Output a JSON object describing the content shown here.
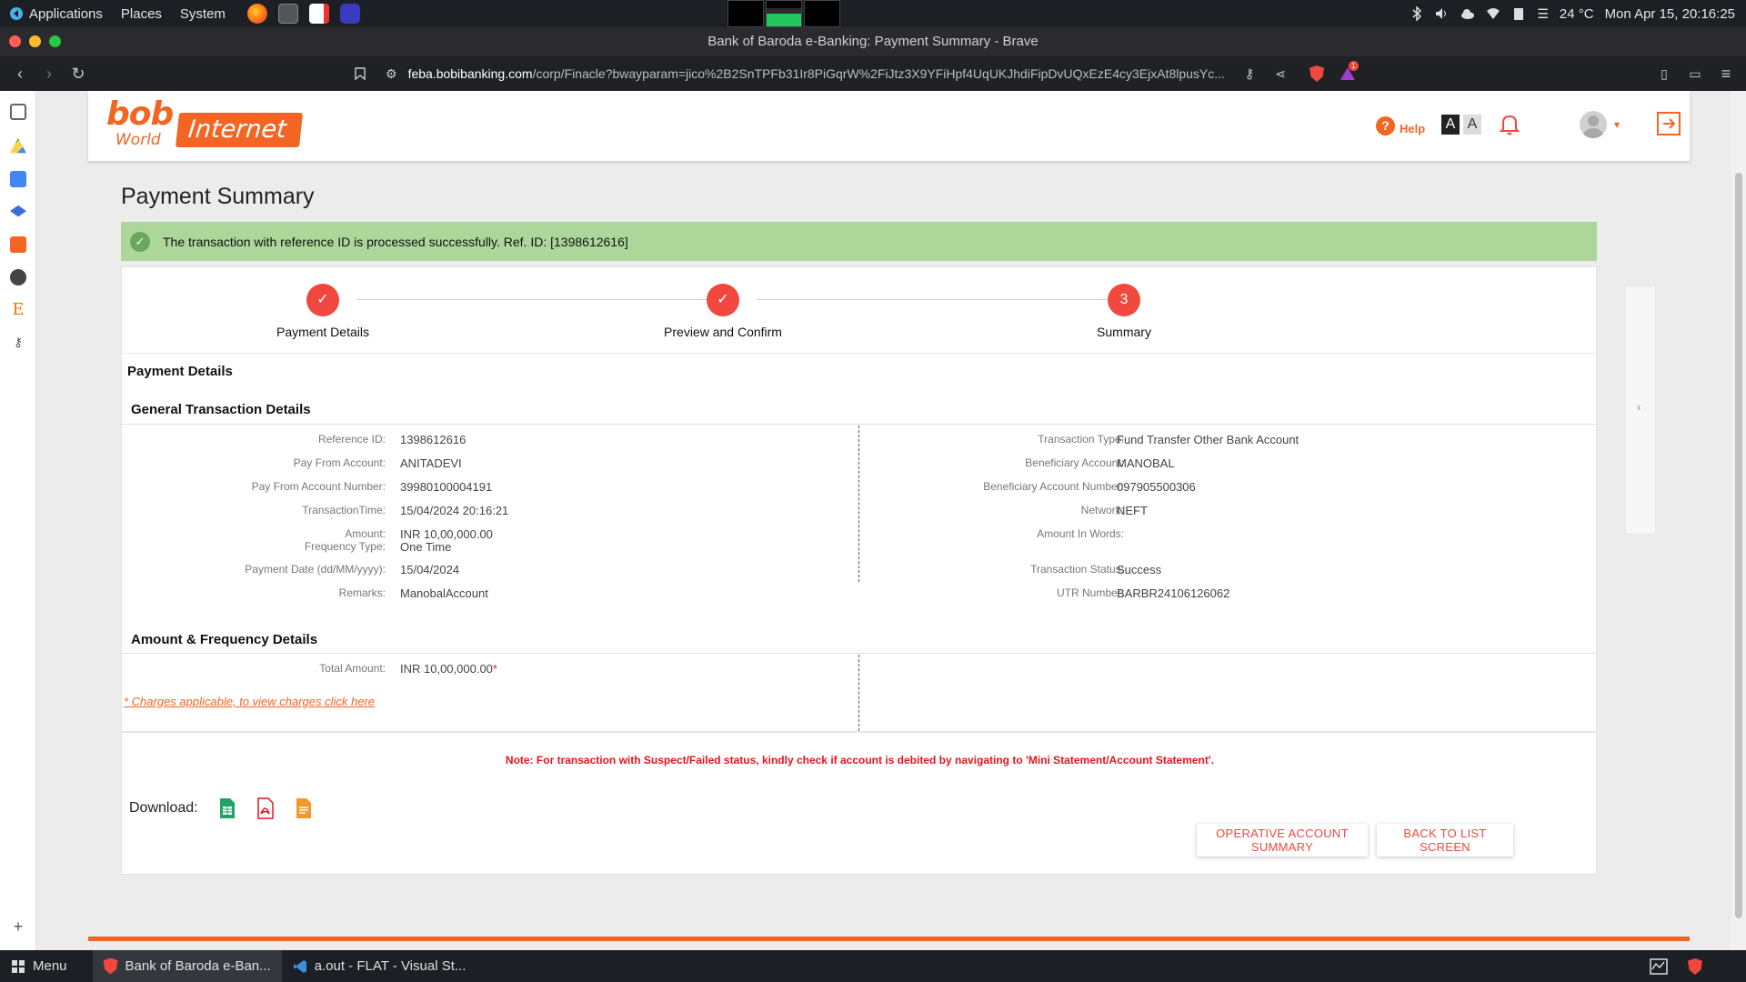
{
  "os_bar": {
    "applications": "Applications",
    "places": "Places",
    "system": "System",
    "temperature": "24 °C",
    "datetime": "Mon Apr 15, 20:16:25"
  },
  "browser": {
    "window_title": "Bank of Baroda e-Banking: Payment Summary - Brave",
    "url_domain": "feba.bobibanking.com",
    "url_path": "/corp/Finacle?bwayparam=jico%2B2SnTPFb31Ir8PiGqrW%2FiJtz3X9YFiHpf4UqUKJhdiFipDvUQxEzE4cy3EjxAt8lpusYc...",
    "notification_count": "1"
  },
  "header": {
    "logo_bob": "bob",
    "logo_world": "World",
    "logo_internet": "Internet",
    "help_label": "Help",
    "font_large": "A",
    "font_small": "A"
  },
  "page": {
    "title": "Payment Summary",
    "success_message": "The transaction with reference ID is processed successfully. Ref. ID: [1398612616]",
    "steps": [
      {
        "label": "Payment Details",
        "marker": "✓"
      },
      {
        "label": "Preview and Confirm",
        "marker": "✓"
      },
      {
        "label": "Summary",
        "marker": "3"
      }
    ],
    "section_title": "Payment Details",
    "general_title": "General Transaction Details",
    "left_fields": [
      {
        "label": "Reference ID:",
        "value": "1398612616"
      },
      {
        "label": "Pay From Account:",
        "value": "ANITADEVI"
      },
      {
        "label": "Pay From Account Number:",
        "value": "39980100004191"
      },
      {
        "label": "TransactionTime:",
        "value": "15/04/2024 20:16:21"
      },
      {
        "label": "Amount:",
        "value": "INR 10,00,000.00"
      },
      {
        "label": "Frequency Type:",
        "value": "One Time"
      },
      {
        "label": "Payment Date (dd/MM/yyyy):",
        "value": "15/04/2024"
      },
      {
        "label": "Remarks:",
        "value": "ManobalAccount"
      }
    ],
    "right_fields": [
      {
        "label": "Transaction Type:",
        "value": "Fund Transfer Other Bank Account"
      },
      {
        "label": "Beneficiary Account:",
        "value": "MANOBAL"
      },
      {
        "label": "Beneficiary Account Number:",
        "value": "097905500306"
      },
      {
        "label": "Network:",
        "value": "NEFT"
      },
      {
        "label": "Amount In Words:",
        "value": ""
      },
      {
        "label": "Transaction Status:",
        "value": "Success"
      },
      {
        "label": "UTR Number:",
        "value": "BARBR24106126062"
      }
    ],
    "amount_title": "Amount & Frequency Details",
    "total_amount_label": "Total Amount:",
    "total_amount_value": "INR 10,00,000.00",
    "asterisk": "*",
    "charges_link": "* Charges applicable, to view charges click here",
    "note": "Note: For transaction with Suspect/Failed status, kindly check if account is debited by navigating to 'Mini Statement/Account Statement'.",
    "download_label": "Download:",
    "btn_operative": "OPERATIVE ACCOUNT SUMMARY",
    "btn_back": "BACK TO LIST SCREEN"
  },
  "taskbar": {
    "menu": "Menu",
    "item1": "Bank of Baroda e-Ban...",
    "item2": "a.out - FLAT - Visual St..."
  },
  "colors": {
    "brand": "#f26522",
    "step": "#f0483e",
    "success_bg": "#add79a"
  }
}
